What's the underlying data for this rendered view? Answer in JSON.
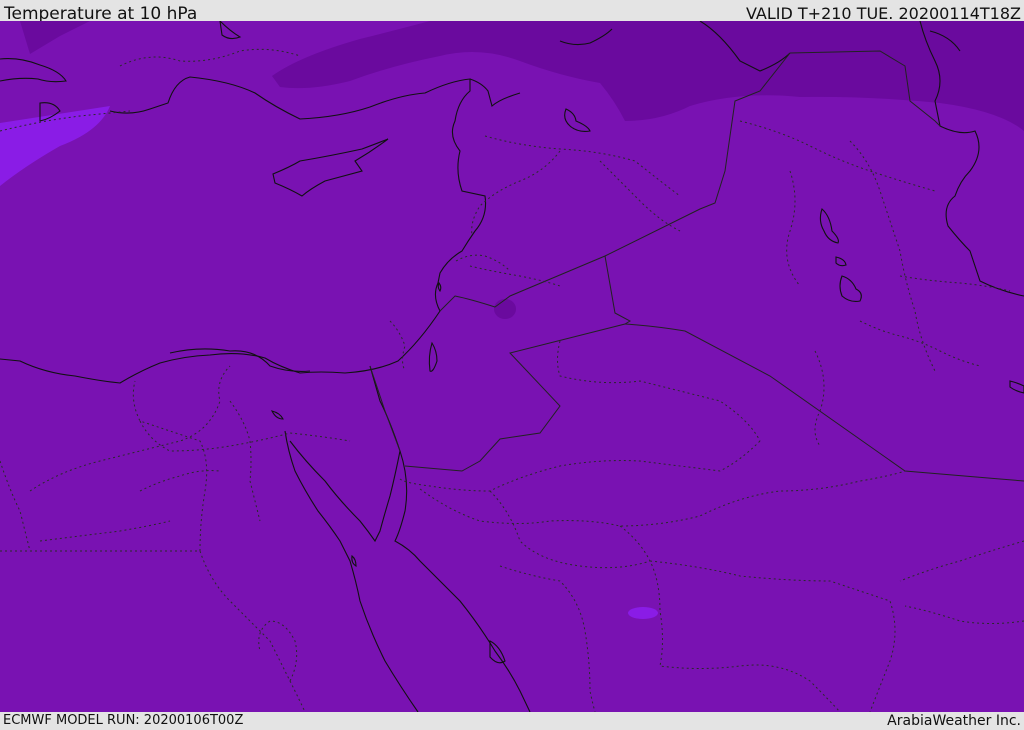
{
  "header": {
    "title": "Temperature at 10 hPa",
    "valid": "VALID T+210 TUE. 20200114T18Z"
  },
  "footer": {
    "model_run": "ECMWF MODEL RUN: 20200106T00Z",
    "credit": "ArabiaWeather Inc."
  },
  "map": {
    "region": "Eastern Mediterranean / Middle East",
    "colors": {
      "base_fill": "#7912b2",
      "cold_band": "#6a0a9e",
      "warm_patch": "#8a1ce6",
      "coastline": "#111111",
      "border": "#222222"
    }
  }
}
